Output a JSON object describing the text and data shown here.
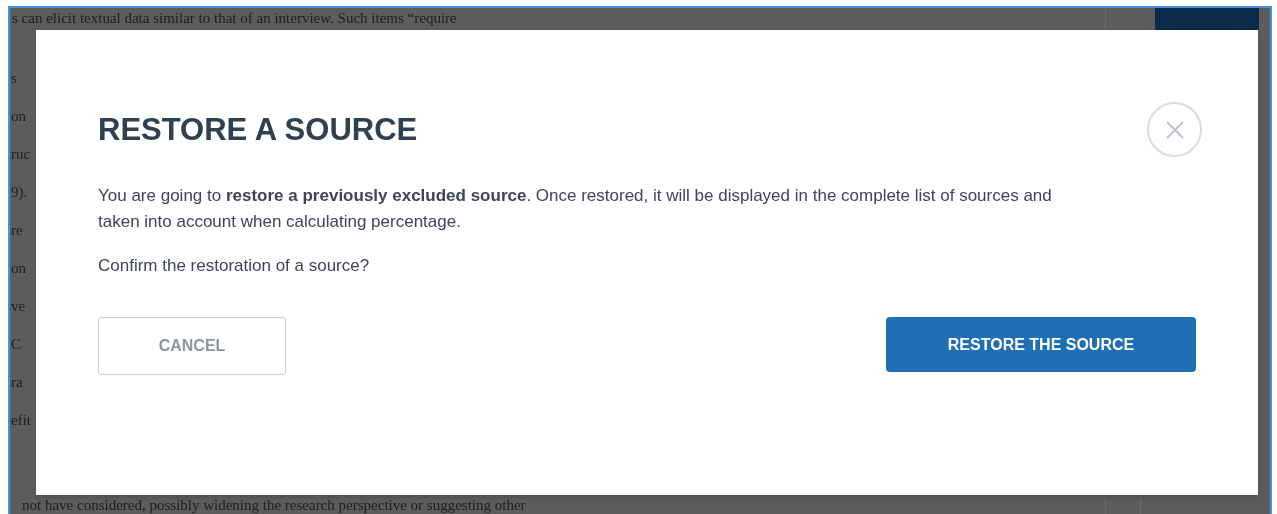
{
  "background_document": {
    "top_line": "s can elicit textual data similar to that of an interview. Such items “require",
    "left_fragments": [
      "s",
      "on",
      "ruc",
      "9).",
      "re",
      "on",
      "ve",
      "C",
      "ra",
      "efit"
    ],
    "bottom_line": "not have considered, possibly widening the research perspective or suggesting other"
  },
  "dialog": {
    "title": "RESTORE A SOURCE",
    "message": "You are going to **restore a previously excluded source**. Once restored, it will be displayed in the complete list of sources and taken into account when calculating percentage.",
    "question": "Confirm the restoration of a source?",
    "buttons": [
      {
        "kind": "secondary",
        "label": "CANCEL"
      },
      {
        "kind": "primary",
        "label": "RESTORE THE SOURCE"
      }
    ]
  }
}
